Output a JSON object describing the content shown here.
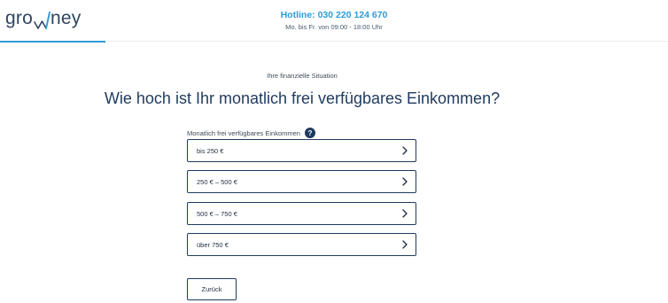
{
  "header": {
    "logo_left": "gro",
    "logo_right": "ney",
    "logo_mark_icon": "w-wave-icon",
    "hotline": "Hotline: 030 220 124 670",
    "hours": "Mo. bis Fr. von 09:00 - 18:00 Uhr"
  },
  "main": {
    "step_label": "Ihre finanzielle Situation",
    "question": "Wie hoch ist Ihr monatlich frei verfügbares Einkommen?",
    "field_label": "Monatlich frei verfügbares Einkommen",
    "help_icon": "?",
    "options": [
      {
        "label": "bis 250 €"
      },
      {
        "label": "250 € – 500 €"
      },
      {
        "label": "500 € – 750 €"
      },
      {
        "label": "über 750 €"
      }
    ],
    "back_label": "Zurück"
  },
  "colors": {
    "accent": "#2e9bd6",
    "primary": "#1f3a5f"
  }
}
